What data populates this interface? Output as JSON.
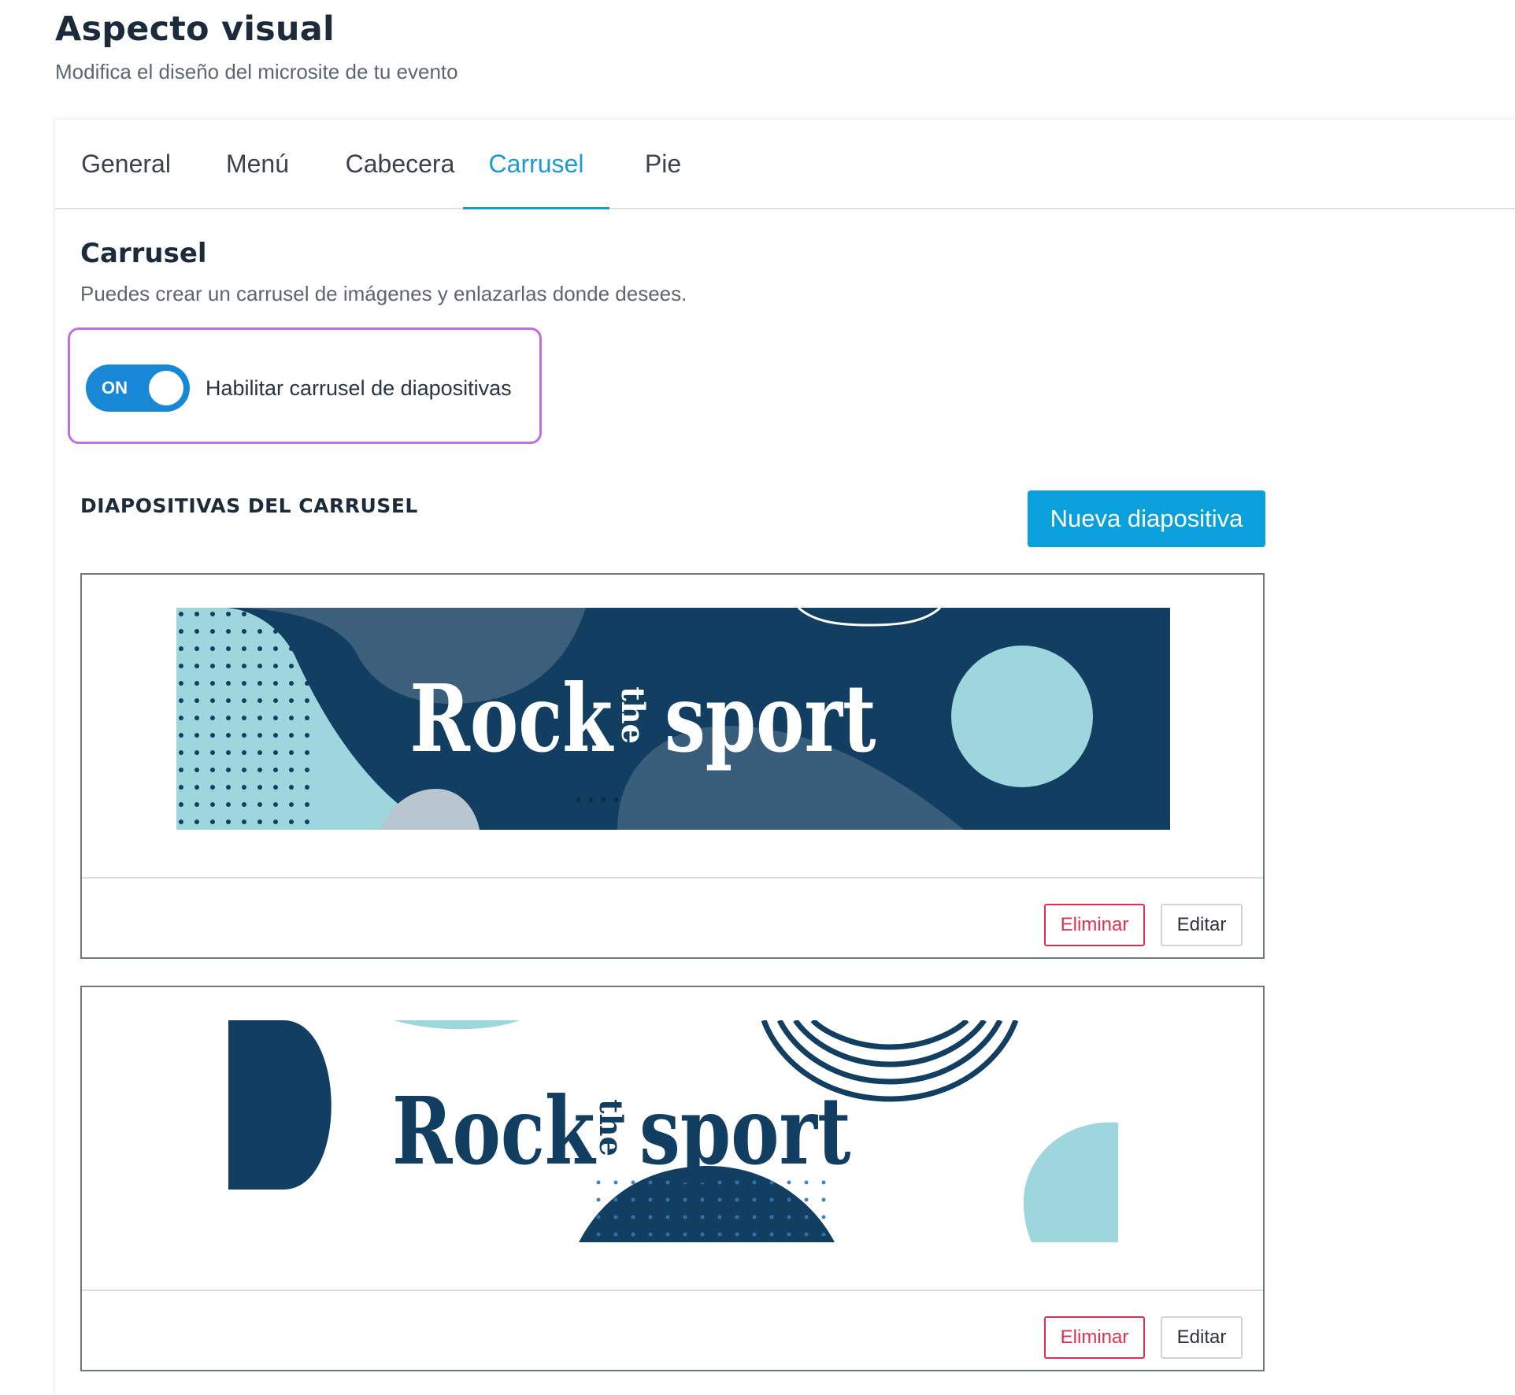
{
  "header": {
    "title": "Aspecto visual",
    "subtitle": "Modifica el diseño del microsite de tu evento"
  },
  "tabs": [
    {
      "label": "General",
      "active": false
    },
    {
      "label": "Menú",
      "active": false
    },
    {
      "label": "Cabecera",
      "active": false
    },
    {
      "label": "Carrusel",
      "active": true
    },
    {
      "label": "Pie",
      "active": false
    }
  ],
  "section": {
    "title": "Carrusel",
    "description": "Puedes crear un carrusel de imágenes y enlazarlas donde desees."
  },
  "toggle": {
    "state_text": "ON",
    "is_on": true,
    "label": "Habilitar carrusel de diapositivas"
  },
  "slides_section": {
    "heading": "DIAPOSITIVAS DEL CARRUSEL",
    "new_button_label": "Nueva diapositiva"
  },
  "slides": [
    {
      "banner": {
        "word1": "Rock",
        "small": "the",
        "word2": "sport",
        "style": "dark"
      },
      "delete_label": "Eliminar",
      "edit_label": "Editar"
    },
    {
      "banner": {
        "word1": "Rock",
        "small": "the",
        "word2": "sport",
        "style": "light"
      },
      "delete_label": "Eliminar",
      "edit_label": "Editar"
    }
  ],
  "colors": {
    "accent": "#1a9ad6",
    "button_primary": "#0aa0dc",
    "toggle_on": "#1787d6",
    "danger": "#e0304f",
    "highlight_border": "#c46de0",
    "banner_navy": "#123f61",
    "banner_teal": "#9ed6de"
  }
}
